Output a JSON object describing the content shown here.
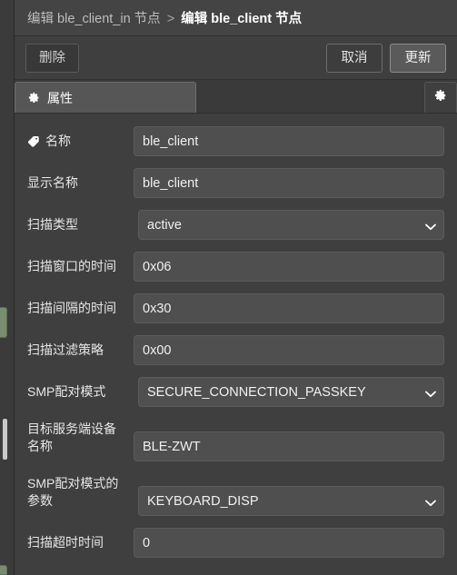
{
  "breadcrumb": {
    "previous": "编辑 ble_client_in 节点",
    "separator": ">",
    "current": "编辑 ble_client 节点"
  },
  "toolbar": {
    "delete_label": "删除",
    "cancel_label": "取消",
    "update_label": "更新"
  },
  "tabs": [
    {
      "label": "属性",
      "icon": "gear-icon",
      "active": true
    }
  ],
  "settings_icon": "gear-icon",
  "form": {
    "fields": [
      {
        "label": "名称",
        "icon": "tag-icon",
        "type": "text",
        "value": "ble_client"
      },
      {
        "label": "显示名称",
        "icon": null,
        "type": "text",
        "value": "ble_client"
      },
      {
        "label": "扫描类型",
        "icon": null,
        "type": "select",
        "value": "active"
      },
      {
        "label": "扫描窗口的时间",
        "icon": null,
        "type": "text",
        "value": "0x06"
      },
      {
        "label": "扫描间隔的时间",
        "icon": null,
        "type": "text",
        "value": "0x30"
      },
      {
        "label": "扫描过滤策略",
        "icon": null,
        "type": "text",
        "value": "0x00"
      },
      {
        "label": "SMP配对模式",
        "icon": null,
        "type": "select",
        "value": "SECURE_CONNECTION_PASSKEY"
      },
      {
        "label": "目标服务端设备名称",
        "icon": null,
        "type": "text",
        "value": "BLE-ZWT",
        "two_line": true
      },
      {
        "label": "SMP配对模式的参数",
        "icon": null,
        "type": "select",
        "value": "KEYBOARD_DISP",
        "two_line": true
      },
      {
        "label": "扫描超时时间",
        "icon": null,
        "type": "text",
        "value": "0"
      }
    ]
  },
  "colors": {
    "panel_bg": "#3f3f3f",
    "input_bg": "#4f4f4f",
    "tab_active_bg": "#565656",
    "update_btn_bg": "#5a5a5a",
    "text": "#e6e6e6",
    "node_accent": "#7a8d70"
  }
}
